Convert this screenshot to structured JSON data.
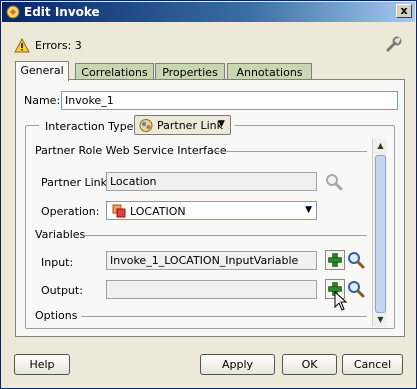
{
  "window": {
    "title": "Edit Invoke",
    "close_glyph": "x"
  },
  "errors": {
    "text": "Errors: 3"
  },
  "tabs": [
    {
      "label": "General",
      "active": true
    },
    {
      "label": "Correlations",
      "active": false
    },
    {
      "label": "Properties",
      "active": false
    },
    {
      "label": "Annotations",
      "active": false
    }
  ],
  "general": {
    "name_label": "Name:",
    "name_value": "Invoke_1",
    "interaction_type_label": "Interaction Type:",
    "interaction_type_value": "Partner Link",
    "partner_role_section": "Partner Role Web Service Interface",
    "partner_link_label": "Partner Link:",
    "partner_link_value": "Location",
    "operation_label": "Operation:",
    "operation_value": "LOCATION",
    "variables_section": "Variables",
    "input_label": "Input:",
    "input_value": "Invoke_1_LOCATION_InputVariable",
    "output_label": "Output:",
    "output_value": "",
    "options_section": "Options"
  },
  "buttons": {
    "help": "Help",
    "apply": "Apply",
    "ok": "OK",
    "cancel": "Cancel"
  },
  "icons": {
    "window": "bpel-icon",
    "warning": "warning-icon",
    "settings": "wrench-icon",
    "search": "magnifier-icon",
    "add": "green-plus-icon"
  },
  "colors": {
    "title_bar": "#0a246a",
    "tab_inactive": "#c9d6b2",
    "panel": "#f8f8f6",
    "add_green": "#2e8b2e"
  }
}
